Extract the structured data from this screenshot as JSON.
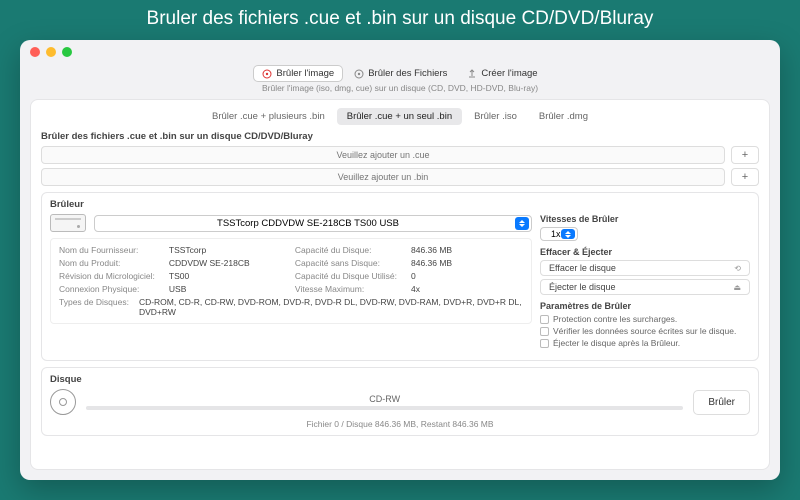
{
  "banner": "Bruler des fichiers .cue et .bin sur un disque CD/DVD/Bluray",
  "toolbar": {
    "burn_image": "Brûler l'image",
    "burn_files": "Brûler des Fichiers",
    "create_image": "Créer l'image",
    "subtitle": "Brûler l'image (iso, dmg, cue) sur un disque (CD, DVD, HD-DVD, Blu-ray)"
  },
  "tabs": {
    "cue_multi": "Brûler .cue + plusieurs .bin",
    "cue_single": "Brûler .cue + un seul .bin",
    "iso": "Brûler .iso",
    "dmg": "Brûler .dmg"
  },
  "section": {
    "title": "Brûler des fichiers .cue et .bin sur un disque CD/DVD/Bluray",
    "placeholder_cue": "Veuillez ajouter un .cue",
    "placeholder_bin": "Veuillez ajouter un .bin",
    "plus": "+"
  },
  "burner": {
    "heading": "Brûleur",
    "device": "TSSTcorp CDDVDW SE-218CB TS00 USB",
    "vendor_lbl": "Nom du Fournisseur:",
    "vendor": "TSSTcorp",
    "product_lbl": "Nom du Produit:",
    "product": "CDDVDW SE-218CB",
    "firmware_lbl": "Révision du Micrologiciel:",
    "firmware": "TS00",
    "conn_lbl": "Connexion Physique:",
    "conn": "USB",
    "cap_lbl": "Capacité du Disque:",
    "cap": "846.36 MB",
    "free_lbl": "Capacité sans Disque:",
    "free": "846.36 MB",
    "used_lbl": "Capacité du Disque Utilisé:",
    "used": "0",
    "speed_lbl": "Vitesse Maximum:",
    "speed": "4x",
    "types_lbl": "Types de Disques:",
    "types": "CD-ROM, CD-R, CD-RW, DVD-ROM, DVD-R, DVD-R DL, DVD-RW, DVD-RAM, DVD+R, DVD+R DL, DVD+RW"
  },
  "right": {
    "speed_h": "Vitesses de Brûler",
    "speed_val": "1x",
    "erase_h": "Effacer & Éjecter",
    "erase_btn": "Effacer le disque",
    "eject_btn": "Éjecter le disque",
    "params_h": "Paramètres de Brûler",
    "opt1": "Protection contre les surcharges.",
    "opt2": "Vérifier les données source écrites sur le disque.",
    "opt3": "Éjecter le disque après la Brûleur."
  },
  "disc": {
    "heading": "Disque",
    "type": "CD-RW",
    "burn_btn": "Brûler",
    "status": "Fichier 0 / Disque 846.36 MB, Restant 846.36 MB"
  }
}
